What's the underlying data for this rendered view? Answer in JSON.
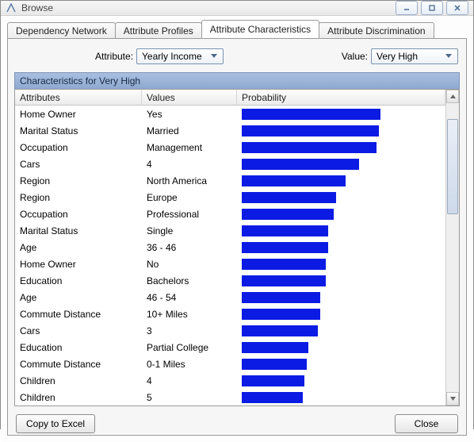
{
  "window": {
    "title": "Browse"
  },
  "tabs": [
    {
      "label": "Dependency Network"
    },
    {
      "label": "Attribute Profiles"
    },
    {
      "label": "Attribute Characteristics"
    },
    {
      "label": "Attribute Discrimination"
    }
  ],
  "filters": {
    "attribute_label": "Attribute:",
    "attribute_value": "Yearly Income",
    "value_label": "Value:",
    "value_value": "Very High"
  },
  "section": {
    "title": "Characteristics for Very High"
  },
  "columns": {
    "attr": "Attributes",
    "val": "Values",
    "prob": "Probability"
  },
  "rows": [
    {
      "attr": "Home Owner",
      "val": "Yes",
      "prob": 71
    },
    {
      "attr": "Marital Status",
      "val": "Married",
      "prob": 70
    },
    {
      "attr": "Occupation",
      "val": "Management",
      "prob": 69
    },
    {
      "attr": "Cars",
      "val": "4",
      "prob": 60
    },
    {
      "attr": "Region",
      "val": "North America",
      "prob": 53
    },
    {
      "attr": "Region",
      "val": "Europe",
      "prob": 48
    },
    {
      "attr": "Occupation",
      "val": "Professional",
      "prob": 47
    },
    {
      "attr": "Marital Status",
      "val": "Single",
      "prob": 44
    },
    {
      "attr": "Age",
      "val": "36 - 46",
      "prob": 44
    },
    {
      "attr": "Home Owner",
      "val": "No",
      "prob": 43
    },
    {
      "attr": "Education",
      "val": "Bachelors",
      "prob": 43
    },
    {
      "attr": "Age",
      "val": "46 - 54",
      "prob": 40
    },
    {
      "attr": "Commute Distance",
      "val": "10+ Miles",
      "prob": 40
    },
    {
      "attr": "Cars",
      "val": "3",
      "prob": 39
    },
    {
      "attr": "Education",
      "val": "Partial College",
      "prob": 34
    },
    {
      "attr": "Commute Distance",
      "val": "0-1 Miles",
      "prob": 33
    },
    {
      "attr": "Children",
      "val": "4",
      "prob": 32
    },
    {
      "attr": "Children",
      "val": "5",
      "prob": 31
    }
  ],
  "buttons": {
    "copy": "Copy to Excel",
    "close": "Close"
  },
  "chart_data": {
    "type": "bar",
    "title": "Characteristics for Very High",
    "xlabel": "Probability",
    "ylabel": "Attribute / Value",
    "series": [
      {
        "name": "Probability",
        "categories": [
          "Home Owner=Yes",
          "Marital Status=Married",
          "Occupation=Management",
          "Cars=4",
          "Region=North America",
          "Region=Europe",
          "Occupation=Professional",
          "Marital Status=Single",
          "Age=36 - 46",
          "Home Owner=No",
          "Education=Bachelors",
          "Age=46 - 54",
          "Commute Distance=10+ Miles",
          "Cars=3",
          "Education=Partial College",
          "Commute Distance=0-1 Miles",
          "Children=4",
          "Children=5"
        ],
        "values": [
          71,
          70,
          69,
          60,
          53,
          48,
          47,
          44,
          44,
          43,
          43,
          40,
          40,
          39,
          34,
          33,
          32,
          31
        ]
      }
    ],
    "xlim": [
      0,
      100
    ]
  }
}
